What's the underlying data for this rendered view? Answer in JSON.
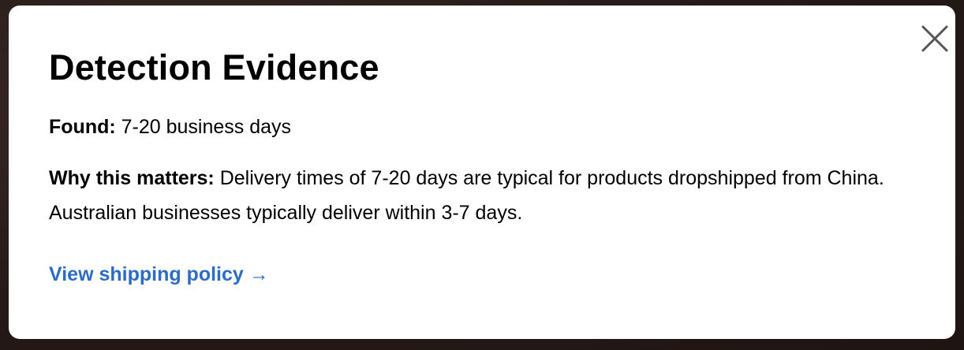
{
  "modal": {
    "title": "Detection Evidence",
    "found_label": "Found:",
    "found_value": "7-20 business days",
    "why_label": "Why this matters:",
    "why_text": "Delivery times of 7-20 days are typical for products dropshipped from China. Australian businesses typically deliver within 3-7 days.",
    "link_label": "View shipping policy →",
    "close_icon": "close-icon"
  },
  "colors": {
    "link": "#2d6cc4",
    "text": "#000000",
    "background": "#ffffff",
    "close_icon": "#555555"
  }
}
